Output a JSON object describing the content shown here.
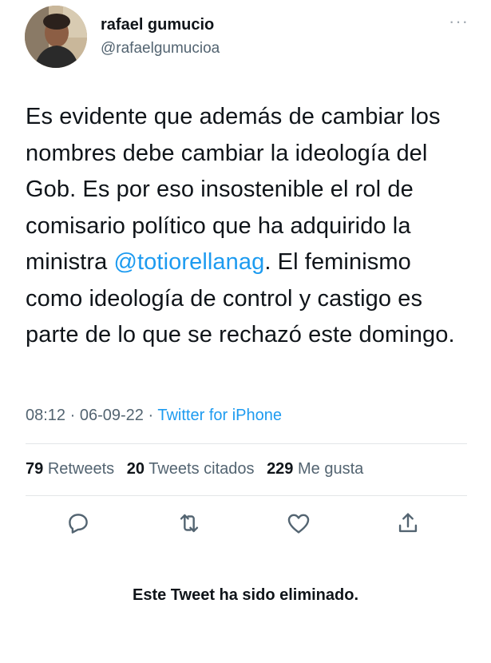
{
  "author": {
    "name": "rafael gumucio",
    "handle": "@rafaelgumucioa"
  },
  "more_icon": "more-horizontal-icon",
  "tweet": {
    "text_before": "Es evidente que además de cambiar los nombres debe cambiar la ideología del Gob. Es por eso insostenible el rol de comisario político que ha adquirido la ministra ",
    "mention": "@totiorellanag",
    "text_after": ". El feminismo como ideología de control y castigo es parte de lo que se rechazó este domingo."
  },
  "meta": {
    "time": "08:12",
    "date": "06-09-22",
    "separator": "·",
    "source": "Twitter for iPhone"
  },
  "stats": {
    "retweets_count": "79",
    "retweets_label": "Retweets",
    "quotes_count": "20",
    "quotes_label": "Tweets citados",
    "likes_count": "229",
    "likes_label": "Me gusta"
  },
  "actions": {
    "reply_icon": "reply-icon",
    "retweet_icon": "retweet-icon",
    "like_icon": "heart-icon",
    "share_icon": "share-icon"
  },
  "notice": "Este Tweet ha sido eliminado.",
  "colors": {
    "link": "#1d9bf0",
    "secondary_text": "#536471",
    "primary_text": "#0f1419"
  }
}
